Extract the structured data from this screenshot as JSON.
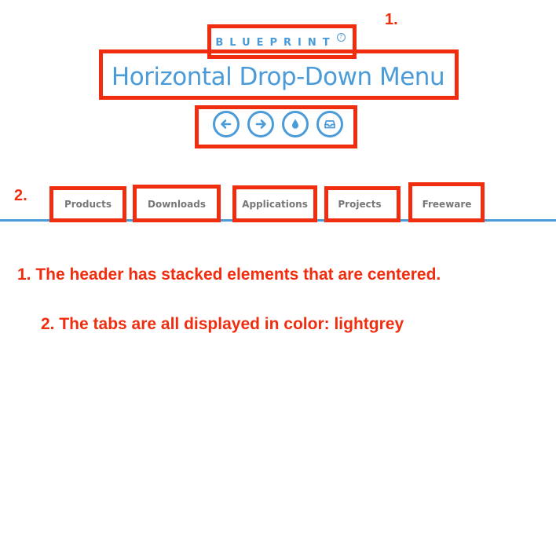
{
  "header": {
    "brand": "BLUEPRINT",
    "help_icon_glyph": "?",
    "title": "Horizontal Drop-Down Menu",
    "icon_buttons": [
      {
        "icon": "arrow-left-icon"
      },
      {
        "icon": "arrow-right-icon"
      },
      {
        "icon": "drop-icon"
      },
      {
        "icon": "inbox-icon"
      }
    ]
  },
  "tabs": [
    {
      "label": "Products"
    },
    {
      "label": "Downloads"
    },
    {
      "label": "Applications"
    },
    {
      "label": "Projects"
    },
    {
      "label": "Freeware"
    }
  ],
  "annotations": {
    "number_1": "1.",
    "number_2": "2.",
    "note_1": "1. The header has stacked elements that are centered.",
    "note_2": "2. The tabs are all displayed in color: lightgrey"
  },
  "colors": {
    "accent_blue": "#4a9bd8",
    "annotation_red": "#f12d0f",
    "tab_text": "#777777"
  }
}
